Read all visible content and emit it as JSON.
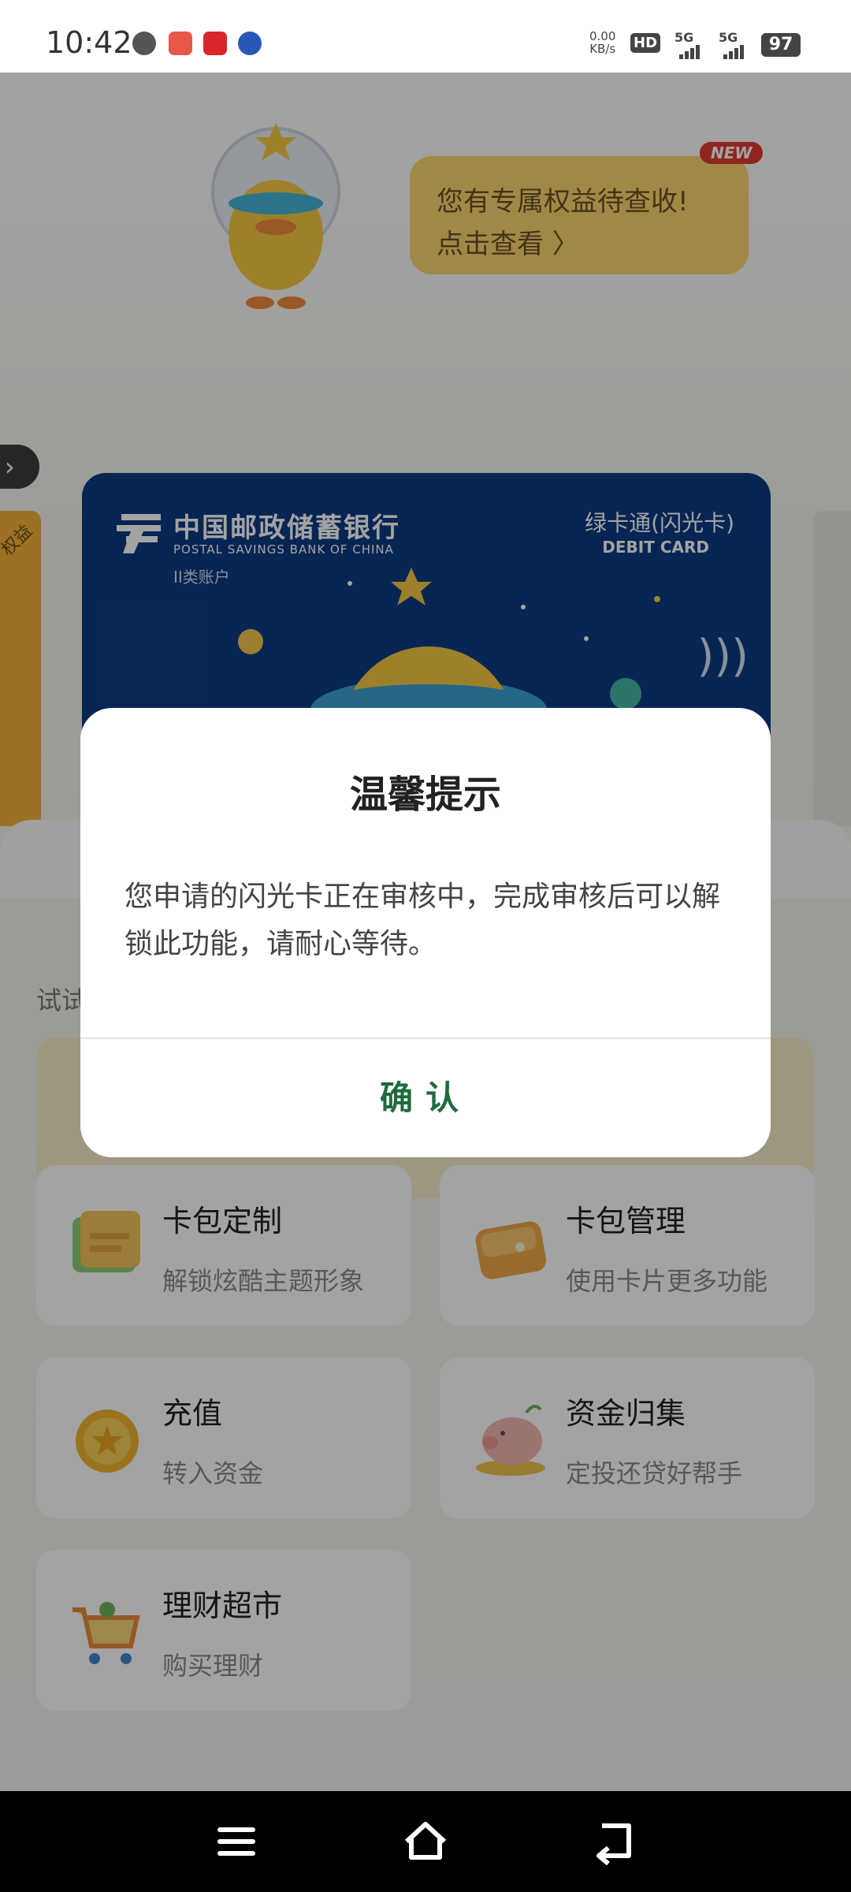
{
  "status_bar": {
    "time": "10:42",
    "net_speed_value": "0.00",
    "net_speed_unit": "KB/s",
    "hd_label": "HD",
    "signal_1": "5G",
    "signal_2": "5G",
    "battery": "97"
  },
  "promo": {
    "bubble_line1": "您有专属权益待查收!",
    "bubble_line2": "点击查看 〉",
    "new_badge": "NEW"
  },
  "side_tab": {
    "label": "权益"
  },
  "card": {
    "bank_name": "中国邮政储蓄银行",
    "bank_name_en": "POSTAL SAVINGS BANK OF CHINA",
    "account_type": "II类账户",
    "product": "绿卡通(闪光卡)",
    "card_type": "DEBIT CARD"
  },
  "page": {
    "try_text": "试试"
  },
  "tiles": [
    {
      "title": "卡包定制",
      "subtitle": "解锁炫酷主题形象"
    },
    {
      "title": "卡包管理",
      "subtitle": "使用卡片更多功能"
    },
    {
      "title": "充值",
      "subtitle": "转入资金"
    },
    {
      "title": "资金归集",
      "subtitle": "定投还贷好帮手"
    },
    {
      "title": "理财超市",
      "subtitle": "购买理财"
    }
  ],
  "dialog": {
    "title": "温馨提示",
    "message": "您申请的闪光卡正在审核中，完成审核后可以解锁此功能，请耐心等待。",
    "confirm_label": "确认"
  },
  "colors": {
    "card_blue": "#0a3b83",
    "confirm_green": "#1e6b3d",
    "bubble_yellow": "#fbd66f",
    "new_red": "#e23b2e"
  }
}
